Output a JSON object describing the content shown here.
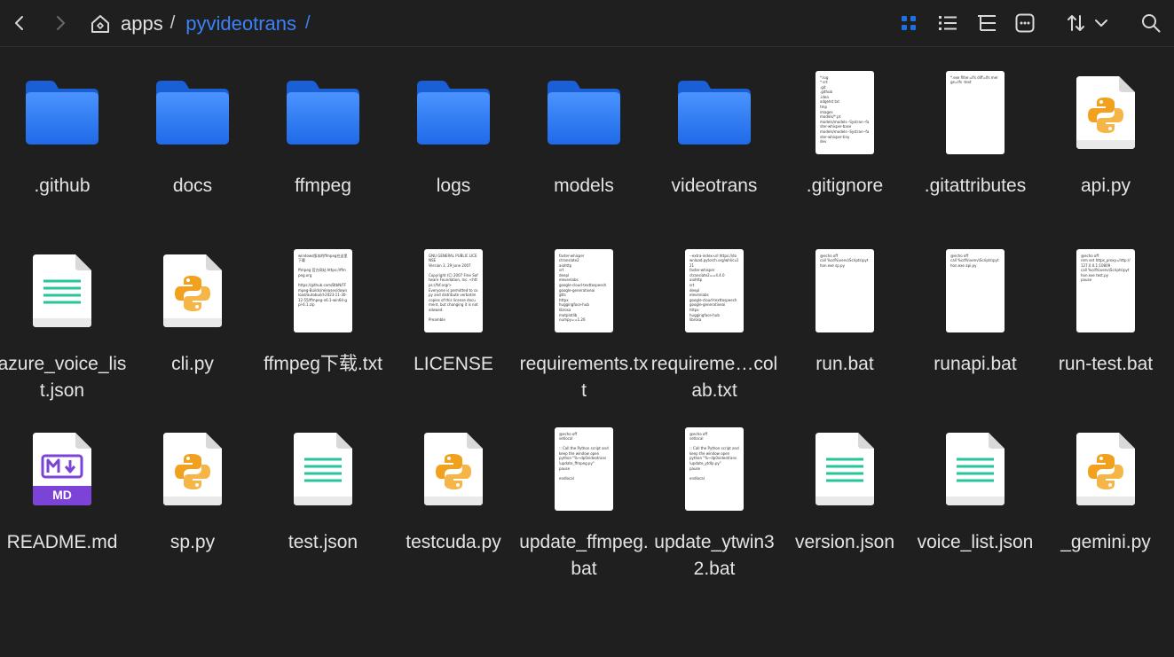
{
  "toolbar": {
    "back_icon": "chevron-left-icon",
    "forward_icon": "chevron-right-icon",
    "home_icon": "home-icon",
    "view_grid_icon": "grid-view-icon",
    "view_list_icon": "list-view-icon",
    "view_tree_icon": "tree-view-icon",
    "more_icon": "more-icon",
    "sort_icon": "sort-icon",
    "sort_dropdown_icon": "chevron-down-icon",
    "search_icon": "search-icon",
    "accent_color": "#1e6fe0"
  },
  "breadcrumb": {
    "items": [
      "apps",
      "pyvideotrans"
    ],
    "separator": "/"
  },
  "files": [
    {
      "name": ".github",
      "type": "folder"
    },
    {
      "name": "docs",
      "type": "folder"
    },
    {
      "name": "ffmpeg",
      "type": "folder"
    },
    {
      "name": "logs",
      "type": "folder"
    },
    {
      "name": "models",
      "type": "folder"
    },
    {
      "name": "videotrans",
      "type": "folder"
    },
    {
      "name": ".gitignore",
      "type": "text",
      "preview": "*.log\n*.srt\n.git\n.github\n.idea\nadgetst.txt\ntmp\nimages\nmodels/*.pt\nmodels/models--Systran--faster-whisper-base\nmodels/models--Systran--faster-whisper-tiny\ndev"
    },
    {
      "name": ".gitattributes",
      "type": "text",
      "preview": "*.exe filter=lfs diff=lfs merge=lfs -text"
    },
    {
      "name": "api.py",
      "type": "python"
    },
    {
      "name": "azure_voice_list.json",
      "type": "json"
    },
    {
      "name": "cli.py",
      "type": "python"
    },
    {
      "name": "ffmpeg下载.txt",
      "type": "text",
      "preview": "windows版本的ffmpeg在这里下载\n\nffmpeg 官方网站 https://ffmpeg.org\n\nhttps://github.com/BtbN/FFmpeg-Builds/releases/download/autobuild-2023-11-30-12-55/ffmpeg-n6.1-win64-gpl-6.1.zip"
    },
    {
      "name": "LICENSE",
      "type": "text",
      "preview": "GNU GENERAL PUBLIC LICENSE\nVersion 3, 29 June 2007\n\nCopyright (C) 2007 Free Software Foundation, Inc. <https://fsf.org/>\nEveryone is permitted to copy and distribute verbatim copies of this license document, but changing it is not allowed.\n\nPreamble"
    },
    {
      "name": "requirements.txt",
      "type": "text",
      "preview": "faster-whisper\nctranslate2\naiohttp\nsrt\ndeepl\nelevenlabs\ngoogle-cloud-texttospeech\ngoogle-generativeai\ngtts\nhttpx\nhuggingface-hub\nlibrosa\nmatplotlib\nnumpy==1.26"
    },
    {
      "name": "requireme…colab.txt",
      "type": "text",
      "preview": "--extra-index-url https://download.pytorch.org/whl/cu121\nfaster-whisper\nctranslate2==4.4.0\naiohttp\nsrt\ndeepl\nelevenlabs\ngoogle-cloud-texttospeech\ngoogle-generativeai\nhttpx\nhuggingface-hub\nlibrosa"
    },
    {
      "name": "run.bat",
      "type": "text",
      "preview": "@echo off\ncall %cd%\\venv\\Scripts\\python.exe sp.py"
    },
    {
      "name": "runapi.bat",
      "type": "text",
      "preview": "@echo off\ncall %cd%\\venv\\Scripts\\python.exe api.py"
    },
    {
      "name": "run-test.bat",
      "type": "text",
      "preview": "@echo off\nrem set https_proxy=http://127.0.0.1:10809\ncall %cd%\\venv\\Scripts\\python.exe test.py\npause"
    },
    {
      "name": "README.md",
      "type": "markdown",
      "badge": "MD"
    },
    {
      "name": "sp.py",
      "type": "python"
    },
    {
      "name": "test.json",
      "type": "json"
    },
    {
      "name": "testcuda.py",
      "type": "python"
    },
    {
      "name": "update_ffmpeg.bat",
      "type": "text",
      "preview": "@echo off\nsetlocal\n\n:: Call the Python script and keep the window open\npython \"%~dp0videotrans\\update_ffmpeg.py\"\npause\n\nendlocal"
    },
    {
      "name": "update_ytwin32.bat",
      "type": "text",
      "preview": "@echo off\nsetlocal\n\n:: Call the Python script and keep the window open\npython \"%~dp0videotrans\\update_ytdlp.py\"\npause\n\nendlocal"
    },
    {
      "name": "version.json",
      "type": "json"
    },
    {
      "name": "voice_list.json",
      "type": "json"
    },
    {
      "name": "_gemini.py",
      "type": "python"
    }
  ]
}
